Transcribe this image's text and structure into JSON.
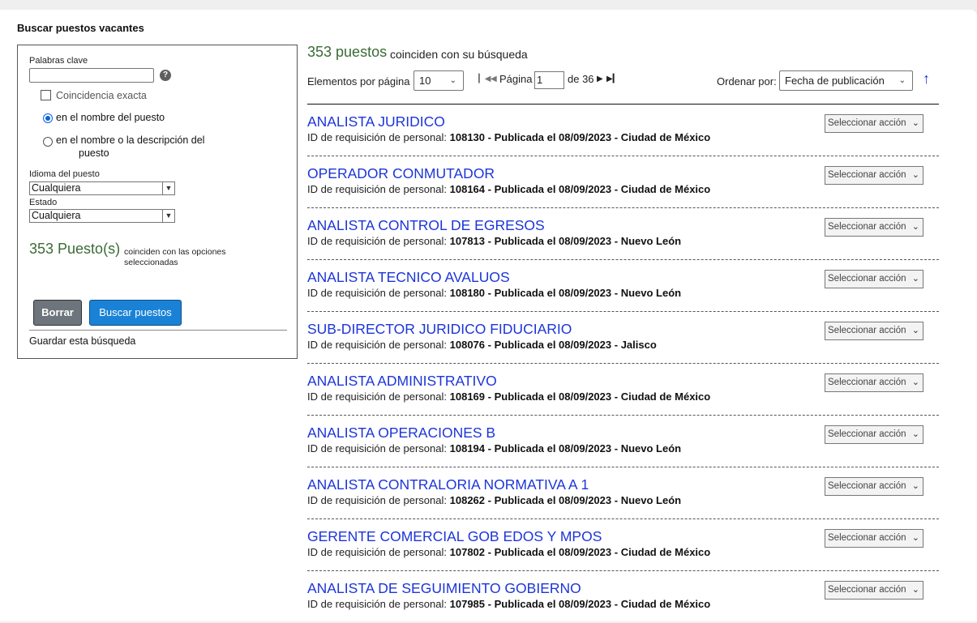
{
  "page": {
    "title": "Buscar puestos vacantes"
  },
  "filters": {
    "keywords_label": "Palabras clave",
    "keywords_value": "",
    "help_glyph": "?",
    "exact_match_label": "Coincidencia exacta",
    "exact_match_checked": false,
    "radio_title": "en el nombre del puesto",
    "radio_title_desc_line1": "en el nombre o la descripción del",
    "radio_title_desc_line2": "puesto",
    "radio_selected": "title",
    "language_label": "Idioma del puesto",
    "language_value": "Cualquiera",
    "state_label": "Estado",
    "state_value": "Cualquiera",
    "match_count": "353 Puesto(s)",
    "match_text_line1": "coinciden con las opciones",
    "match_text_line2": "seleccionadas",
    "clear_label": "Borrar",
    "search_label": "Buscar puestos",
    "save_label": "Guardar esta búsqueda"
  },
  "results": {
    "count": "353 puestos",
    "count_text": "coinciden con su búsqueda",
    "per_page_label": "Elementos por página",
    "per_page_value": "10",
    "page_label": "Página",
    "page_value": "1",
    "page_of": "de 36",
    "sort_label": "Ordenar por:",
    "sort_value": "Fecha de publicación",
    "sort_direction_glyph": "↑"
  },
  "jobs": [
    {
      "title": "ANALISTA JURIDICO",
      "id_label": "ID de requisición de personal:",
      "id": "108130",
      "published": "Publicada el 08/09/2023",
      "location": "Ciudad de México",
      "action": "Seleccionar acción"
    },
    {
      "title": "OPERADOR CONMUTADOR",
      "id_label": "ID de requisición de personal:",
      "id": "108164",
      "published": "Publicada el 08/09/2023",
      "location": "Ciudad de México",
      "action": "Seleccionar acción"
    },
    {
      "title": "ANALISTA CONTROL DE EGRESOS",
      "id_label": "ID de requisición de personal:",
      "id": "107813",
      "published": "Publicada el 08/09/2023",
      "location": "Nuevo León",
      "action": "Seleccionar acción"
    },
    {
      "title": "ANALISTA TECNICO AVALUOS",
      "id_label": "ID de requisición de personal:",
      "id": "108180",
      "published": "Publicada el 08/09/2023",
      "location": "Nuevo León",
      "action": "Seleccionar acción"
    },
    {
      "title": "SUB-DIRECTOR JURIDICO FIDUCIARIO",
      "id_label": "ID de requisición de personal:",
      "id": "108076",
      "published": "Publicada el 08/09/2023",
      "location": "Jalisco",
      "action": "Seleccionar acción"
    },
    {
      "title": "ANALISTA ADMINISTRATIVO",
      "id_label": "ID de requisición de personal:",
      "id": "108169",
      "published": "Publicada el 08/09/2023",
      "location": "Ciudad de México",
      "action": "Seleccionar acción"
    },
    {
      "title": "ANALISTA OPERACIONES B",
      "id_label": "ID de requisición de personal:",
      "id": "108194",
      "published": "Publicada el 08/09/2023",
      "location": "Nuevo León",
      "action": "Seleccionar acción"
    },
    {
      "title": "ANALISTA CONTRALORIA NORMATIVA A 1",
      "id_label": "ID de requisición de personal:",
      "id": "108262",
      "published": "Publicada el 08/09/2023",
      "location": "Nuevo León",
      "action": "Seleccionar acción"
    },
    {
      "title": "GERENTE COMERCIAL GOB EDOS Y MPOS",
      "id_label": "ID de requisición de personal:",
      "id": "107802",
      "published": "Publicada el 08/09/2023",
      "location": "Ciudad de México",
      "action": "Seleccionar acción"
    },
    {
      "title": "ANALISTA DE SEGUIMIENTO GOBIERNO",
      "id_label": "ID de requisición de personal:",
      "id": "107985",
      "published": "Publicada el 08/09/2023",
      "location": "Ciudad de México",
      "action": "Seleccionar acción"
    }
  ],
  "colors": {
    "link": "#1c35d9",
    "count_green": "#3a6b35",
    "primary_button": "#1a82d6",
    "secondary_button": "#6d747c"
  },
  "icons": [
    "help-icon",
    "chevron-down-icon",
    "first-page-icon",
    "prev-page-icon",
    "next-page-icon",
    "last-page-icon",
    "sort-ascending-icon"
  ]
}
